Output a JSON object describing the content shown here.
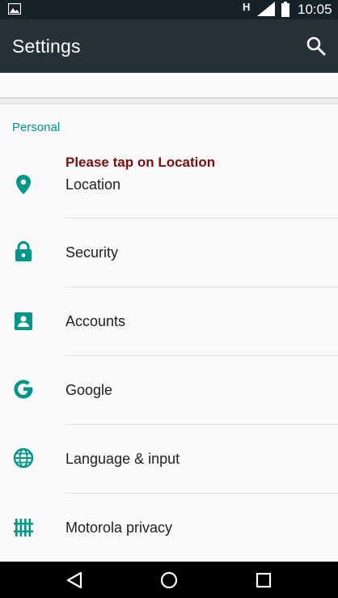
{
  "status_bar": {
    "network_label": "H",
    "time": "10:05"
  },
  "app_bar": {
    "title": "Settings",
    "search_icon": "search-icon"
  },
  "section": {
    "header": "Personal"
  },
  "hint": "Please tap on Location",
  "items": [
    {
      "label": "Location",
      "icon": "location-pin-icon"
    },
    {
      "label": "Security",
      "icon": "lock-icon"
    },
    {
      "label": "Accounts",
      "icon": "account-box-icon"
    },
    {
      "label": "Google",
      "icon": "google-g-icon"
    },
    {
      "label": "Language & input",
      "icon": "globe-icon"
    },
    {
      "label": "Motorola privacy",
      "icon": "grid-icon"
    }
  ],
  "colors": {
    "status_bar": "#172128",
    "app_bar": "#263238",
    "accent": "#009688",
    "hint": "#7b0e0e"
  }
}
